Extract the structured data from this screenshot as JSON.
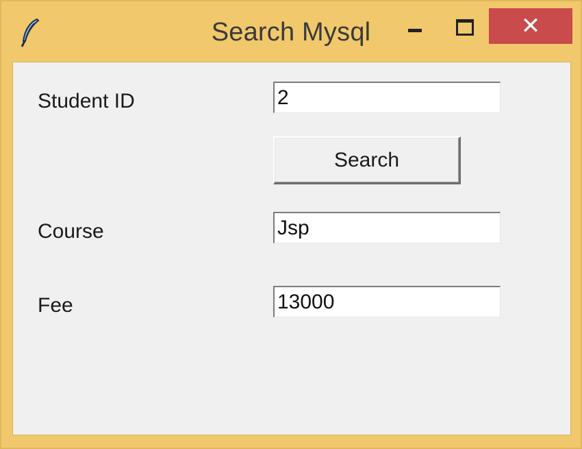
{
  "window": {
    "title": "Search Mysql",
    "app_icon": "feather-icon",
    "controls": {
      "minimize_icon": "minimize-icon",
      "maximize_icon": "maximize-icon",
      "close_glyph": "✕"
    },
    "frame_color": "#f1c86b",
    "close_color": "#c94b4b"
  },
  "form": {
    "student_id": {
      "label": "Student ID",
      "value": "2"
    },
    "search_button": {
      "label": "Search"
    },
    "course": {
      "label": "Course",
      "value": "Jsp"
    },
    "fee": {
      "label": "Fee",
      "value": "13000"
    }
  }
}
